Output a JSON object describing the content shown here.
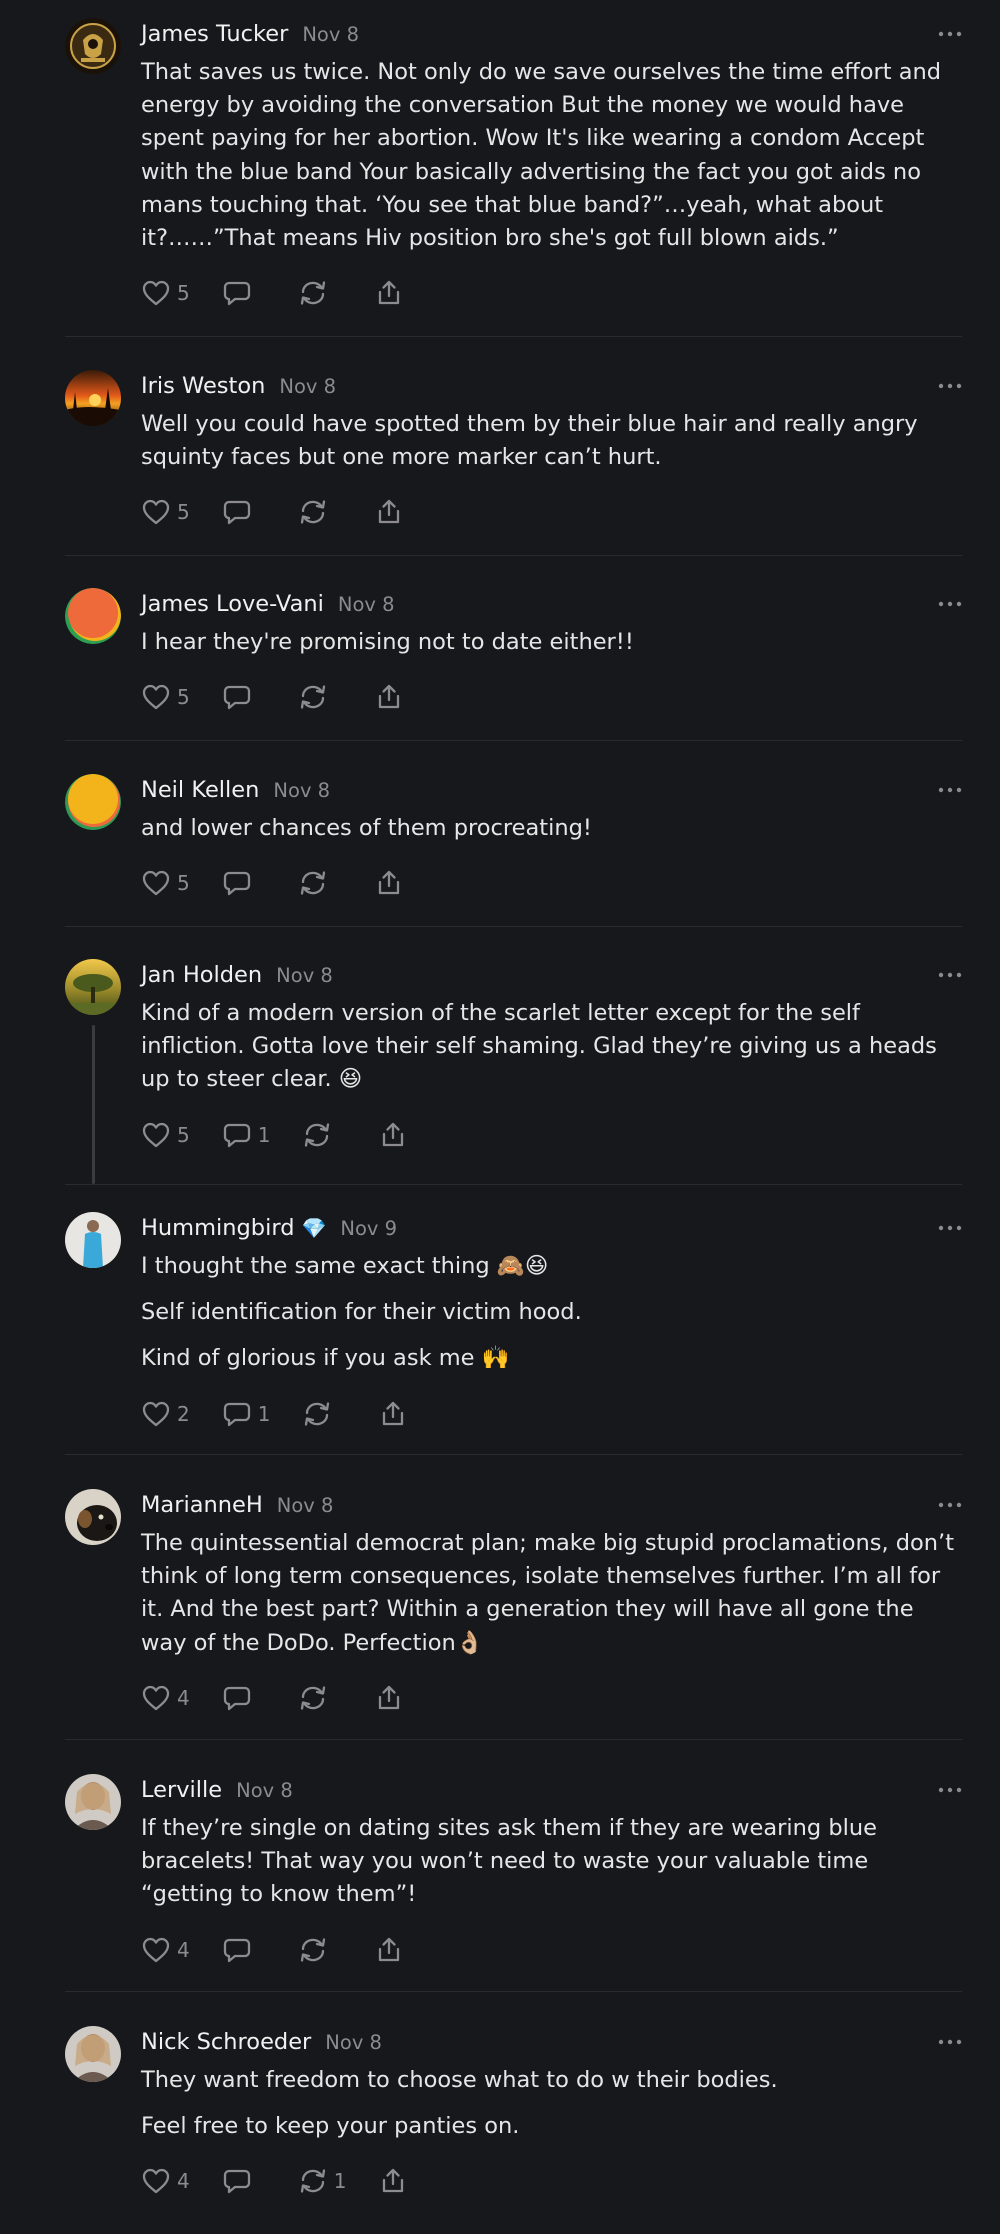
{
  "comments": [
    {
      "name": "James Tucker",
      "date": "Nov 8",
      "avatar_icon": "crest-emblem",
      "paragraphs": [
        "That saves us twice. Not only do we save ourselves the time effort and energy by avoiding the conversation But the money we would have spent paying for her abortion. Wow It's like wearing a condom Accept with the blue band Your basically advertising the fact you got aids no mans touching that. ‘You see that blue band?”…yeah, what about it?……”That means Hiv position bro she's got full blown aids.”"
      ],
      "likes": "5",
      "replies": "",
      "reposts": ""
    },
    {
      "name": "Iris Weston",
      "date": "Nov 8",
      "avatar_icon": "sunset-photo",
      "paragraphs": [
        "Well you could have spotted them by their blue hair and really angry squinty faces but one more marker can’t hurt."
      ],
      "likes": "5",
      "replies": "",
      "reposts": ""
    },
    {
      "name": "James Love-Vani",
      "date": "Nov 8",
      "avatar_icon": "gradient-orange",
      "paragraphs": [
        "I hear they're promising not to date either!!"
      ],
      "likes": "5",
      "replies": "",
      "reposts": ""
    },
    {
      "name": "Neil Kellen",
      "date": "Nov 8",
      "avatar_icon": "gradient-yellow",
      "paragraphs": [
        "and lower chances of them procreating!"
      ],
      "likes": "5",
      "replies": "",
      "reposts": ""
    },
    {
      "name": "Jan Holden",
      "date": "Nov 8",
      "avatar_icon": "tree-photo",
      "paragraphs": [
        "Kind of a modern version of the scarlet letter except for the self infliction. Gotta love their self shaming. Glad they’re giving us a heads up to steer clear. 😆"
      ],
      "likes": "5",
      "replies": "1",
      "reposts": ""
    },
    {
      "name": "Hummingbird",
      "badge": "💎",
      "date": "Nov 9",
      "avatar_icon": "person-photo",
      "paragraphs": [
        "I thought the same exact thing 🙈😆",
        "Self identification for their victim hood.",
        "Kind of glorious if you ask me 🙌"
      ],
      "likes": "2",
      "replies": "1",
      "reposts": ""
    },
    {
      "name": "MarianneH",
      "date": "Nov 8",
      "avatar_icon": "dog-photo",
      "paragraphs": [
        "The quintessential democrat plan; make big stupid proclamations, don’t think of long term consequences, isolate themselves further. I’m all for it. And the best part? Within a generation they will have all gone the way of the DoDo. Perfection👌🏼"
      ],
      "likes": "4",
      "replies": "",
      "reposts": ""
    },
    {
      "name": "Lerville",
      "date": "Nov 8",
      "avatar_icon": "portrait-photo",
      "paragraphs": [
        "If they’re single on dating sites ask them if they are wearing blue bracelets! That way you won’t need to waste your valuable time “getting to know them”!"
      ],
      "likes": "4",
      "replies": "",
      "reposts": ""
    },
    {
      "name": "Nick Schroeder",
      "date": "Nov 8",
      "avatar_icon": "portrait-photo",
      "paragraphs": [
        "They want freedom to choose what to do w their bodies.",
        "Feel free to keep your panties on."
      ],
      "likes": "4",
      "replies": "",
      "reposts": "1"
    }
  ]
}
